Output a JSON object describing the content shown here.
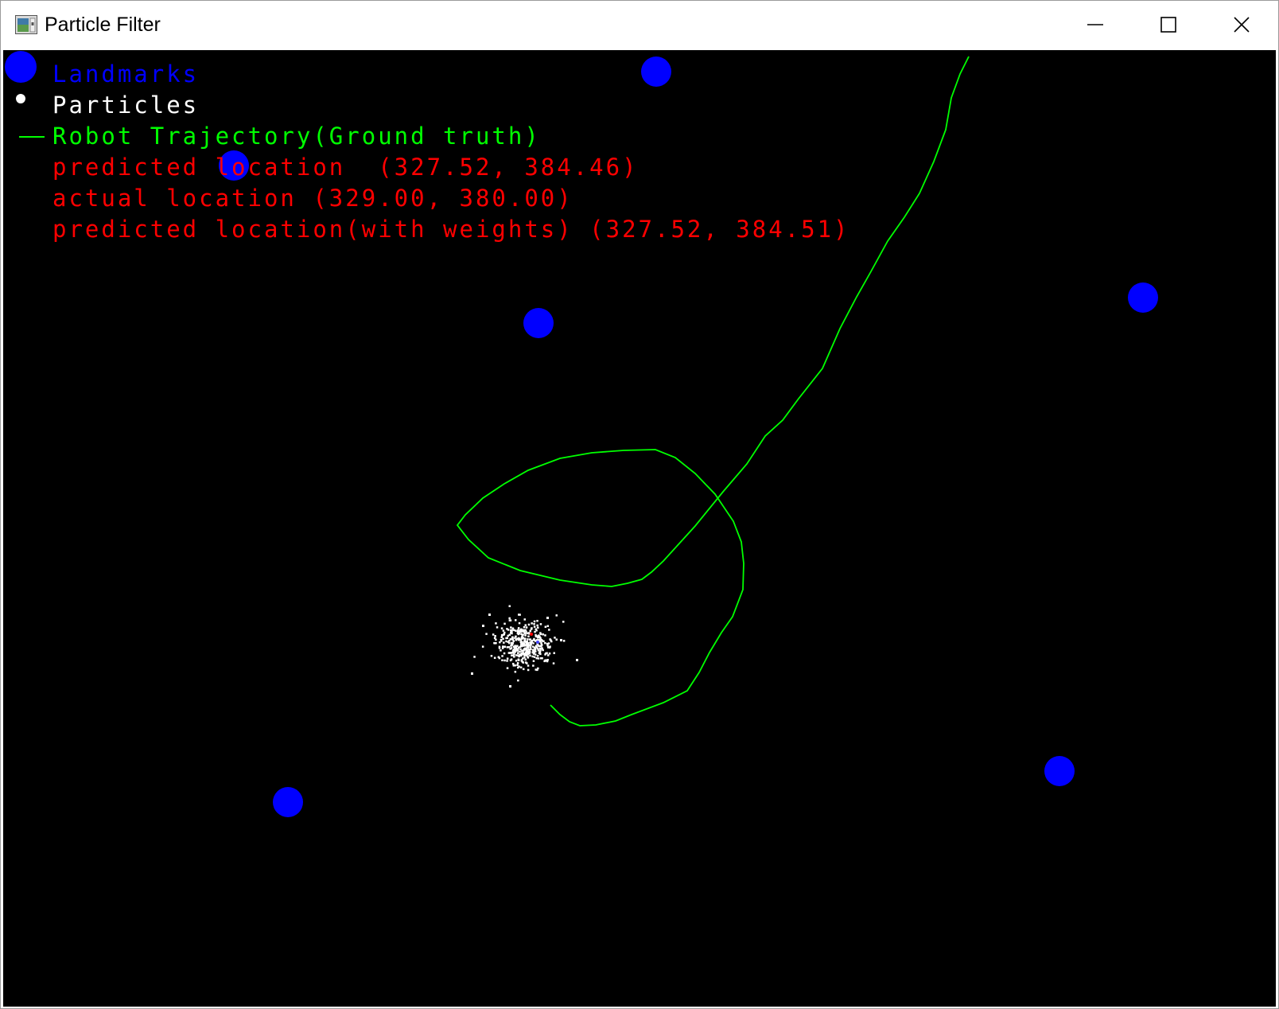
{
  "window": {
    "title": "Particle Filter",
    "icon": "opencv-window-icon",
    "controls": [
      "minimize-icon",
      "maximize-icon",
      "close-icon"
    ]
  },
  "legend": {
    "landmarks_label": "Landmarks",
    "particles_label": "Particles",
    "trajectory_label": "Robot Trajectory(Ground truth)",
    "predicted_label": "predicted location  (327.52, 384.46)",
    "actual_label": "actual location (329.00, 380.00)",
    "weighted_label": "predicted location(with weights) (327.52, 384.51)"
  },
  "colors": {
    "background": "#000000",
    "landmark": "#0000ff",
    "particle": "#ffffff",
    "trajectory": "#00ff00",
    "status_text": "#ff0000"
  },
  "scene": {
    "landmarks": [
      "landmark",
      "landmark",
      "landmark",
      "landmark",
      "landmark",
      "landmark",
      "landmark"
    ],
    "particle_cloud": "particle-cloud",
    "trajectory": "robot-trajectory"
  }
}
